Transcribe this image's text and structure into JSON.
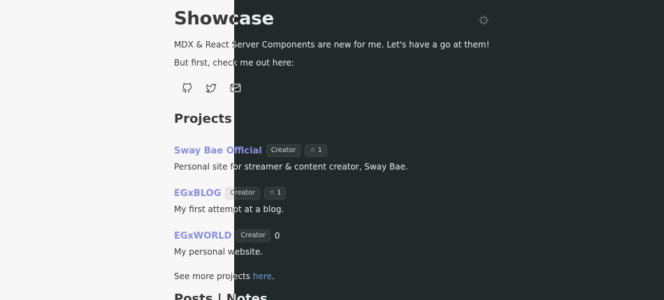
{
  "header": {
    "title": "Showcase",
    "theme_icon": "loader-icon"
  },
  "intro": {
    "line1": "MDX & React Server Components are new for me. Let's have a go at them!",
    "line2": "But first, check me out here:"
  },
  "social": [
    {
      "name": "github-icon"
    },
    {
      "name": "twitter-icon"
    },
    {
      "name": "mail-icon"
    }
  ],
  "projects_heading": "Projects",
  "projects": [
    {
      "title": "Sway Bae Official",
      "badge": "Creator",
      "stars": "1",
      "description": "Personal site for streamer & content creator, Sway Bae."
    },
    {
      "title": "EGxBLOG",
      "badge": "Creator",
      "stars": "1",
      "description": "My first attempt at a blog."
    },
    {
      "title": "EGxWORLD",
      "badge": "Creator",
      "stars": "0",
      "description": "My personal website."
    }
  ],
  "see_more": {
    "prefix": "See more projects ",
    "link": "here",
    "suffix": "."
  },
  "posts_heading": "Posts | Notes",
  "colors": {
    "light_bg": "#f7f7f7",
    "dark_bg": "#212a29",
    "link": "#8b8fe0",
    "inline_link": "#6a9ee6"
  }
}
